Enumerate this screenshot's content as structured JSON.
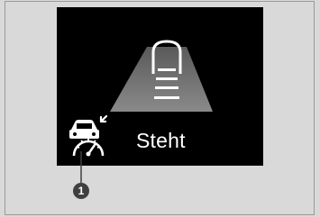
{
  "display": {
    "status_text": "Steht",
    "icons": {
      "lane": "lane-camera-road-icon",
      "system": "car-speedometer-icon"
    }
  },
  "callouts": [
    {
      "label": "1"
    }
  ],
  "colors": {
    "background": "#d9d9d9",
    "display": "#000000",
    "road": "#7f7f7f",
    "lane_markings": "#ffffff",
    "callout": "#404040"
  }
}
